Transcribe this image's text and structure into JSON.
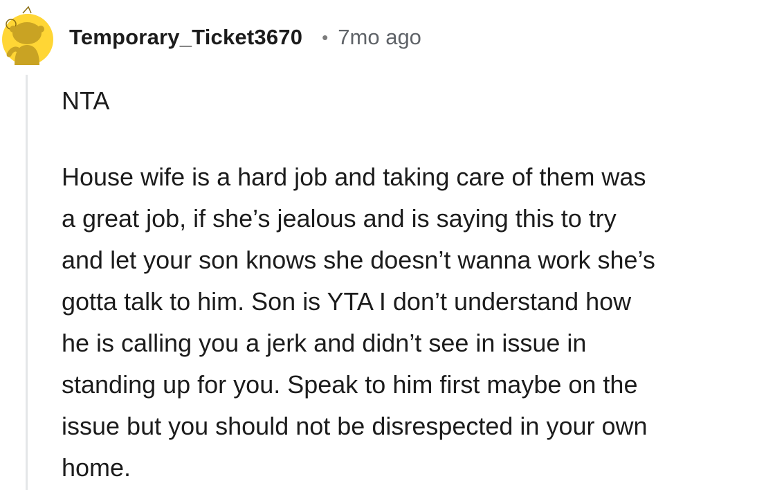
{
  "comment": {
    "username": "Temporary_Ticket3670",
    "separator": "•",
    "timestamp": "7mo ago",
    "verdict": "NTA",
    "body_lines": [
      "House wife is a hard job and taking care of them was",
      "a great job, if she’s jealous and is saying this to try",
      "and let your son knows she doesn’t wanna work she’s",
      "gotta talk to him. Son is YTA I don’t understand how",
      "he is calling you a jerk and didn’t see in issue in",
      "standing up for you. Speak to him first maybe on the",
      "issue but you should not be disrespected in your own",
      "home."
    ]
  },
  "avatar": {
    "icon": "reddit-snoo-avatar-icon",
    "background_color": "#ffd635",
    "figure_color": "#c9a323"
  },
  "colors": {
    "text": "#1c1c1c",
    "meta": "#5f6368",
    "thread_line": "#e4e6e8"
  }
}
